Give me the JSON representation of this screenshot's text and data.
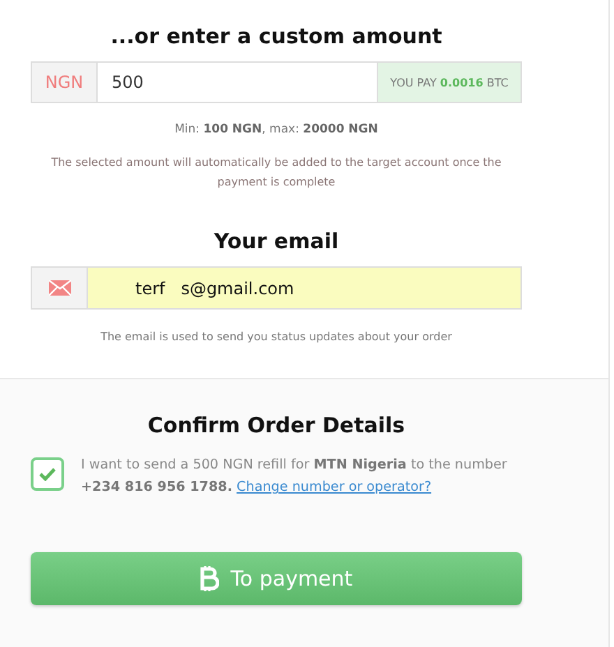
{
  "amount_section": {
    "heading": "...or enter a custom amount",
    "currency": "NGN",
    "amount": "500",
    "you_pay": "YOU PAY **0.0016** BTC",
    "limits": "Min: **100 NGN**, max: **20000 NGN**",
    "note": "The selected amount will automatically be added to the target account once the payment is complete"
  },
  "email_section": {
    "heading": "Your email",
    "value": "terf   s@gmail.com",
    "note": "The email is used to send you status updates about your order"
  },
  "confirm_section": {
    "heading": "Confirm Order Details",
    "checked": true,
    "text": "I want to send a 500 NGN refill for **MTN Nigeria** to the number **+234 816 956 1788.**",
    "link": "Change number or operator?"
  },
  "pay_button": {
    "label": "To payment"
  }
}
